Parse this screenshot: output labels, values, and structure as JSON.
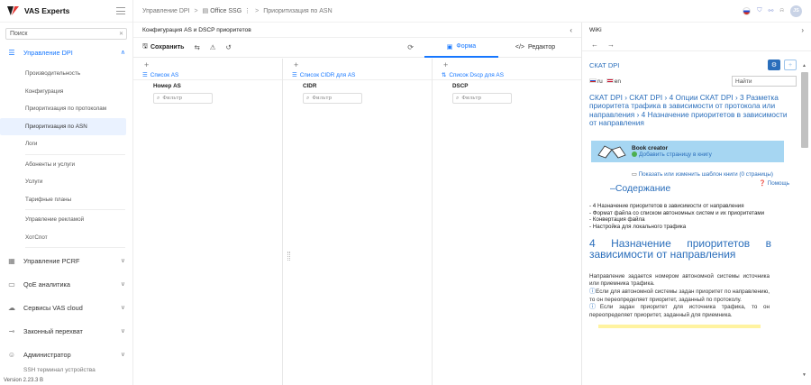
{
  "app": {
    "brand": "VAS Experts",
    "version": "Version 2.23.3 B"
  },
  "sidebar": {
    "search_placeholder": "Поиск",
    "groups": [
      {
        "label": "Управление DPI",
        "icon": "list-icon",
        "items": [
          "Производительность",
          "Конфигурация",
          "Приоритизация по протоколам",
          "Приоритизация по ASN",
          "Логи",
          "Абоненты и услуги",
          "Услуги",
          "Тарифные планы",
          "Управление рекламой",
          "ХотСпот"
        ]
      },
      {
        "label": "Управление PCRF",
        "icon": "grid-icon"
      },
      {
        "label": "QoE аналитика",
        "icon": "chart-icon"
      },
      {
        "label": "Сервисы VAS cloud",
        "icon": "cloud-icon"
      },
      {
        "label": "Законный перехват",
        "icon": "intercept-icon"
      },
      {
        "label": "Администратор",
        "icon": "admin-users-icon"
      }
    ],
    "partial_item": "SSH терминал устройства"
  },
  "topbar": {
    "breadcrumbs": [
      "Управление DPI",
      "Office SSG",
      "Приоритизация по ASN"
    ],
    "icons": [
      "flag-ru-icon",
      "shield-icon",
      "plug-icon",
      "bell-icon"
    ],
    "avatar": "JS"
  },
  "middle": {
    "title": "Конфигурация AS и DSCP приоритетов",
    "toolbar": {
      "save_label": "Сохранить",
      "form_tab": "Форма",
      "editor_tab": "Редактор"
    },
    "columns": [
      {
        "title": "Список AS",
        "header": "Номер AS",
        "filter_placeholder": "Фильтр"
      },
      {
        "title": "Список CIDR для AS",
        "header": "CIDR",
        "filter_placeholder": "Фильтр"
      },
      {
        "title": "Список Dscp для AS",
        "header": "DSCP",
        "filter_placeholder": "Фильтр"
      }
    ]
  },
  "wiki": {
    "title": "WiKi",
    "brand": "СКАТ DPI",
    "lang_ru": "ru",
    "lang_en": "en",
    "search_placeholder": "Найти",
    "breadcrumbs": "СКАТ DPI › СКАТ DPI › 4 Опции СКАТ DPI › 3 Разметка приоритета трафика в зависимости от протокола или направления › 4 Назначение приоритетов в зависимости от направления",
    "book_title": "Book creator",
    "book_add": "Добавить страницу в книгу",
    "book_show": "Показать или изменить шаблон книги (0 страницы)",
    "toc_title": "Содержание",
    "help": "Помощь",
    "toc": [
      "- 4 Назначение приоритетов в зависимости от направления",
      "- Формат файла со списком автономных систем и их приоритетами",
      "- Конвертация файла",
      "- Настройка для локального трафика"
    ],
    "heading": "4 Назначение приоритетов в зависимости от направления",
    "para1": "Направление задается номером автономной системы источника или приемника трафика.",
    "note1": "Если для автономной системы задан приоритет по направлению, то он переопределяет приоритет, заданный по протоколу.",
    "note2": "Если задан приоритет для источника трафика, то он переопределяет приоритет, заданный для приемника."
  },
  "colors": {
    "accent": "#1677ff",
    "wiki_link": "#2a6ebb",
    "book_bg": "#a6d6f2",
    "active_item_bg": "#eaf2ff"
  }
}
